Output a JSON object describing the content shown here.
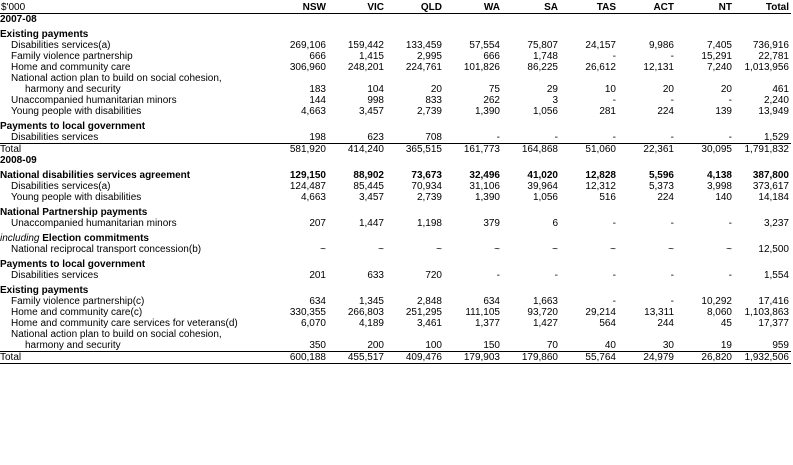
{
  "header": {
    "unit": "$'000",
    "columns": [
      "NSW",
      "VIC",
      "QLD",
      "WA",
      "SA",
      "TAS",
      "ACT",
      "NT",
      "Total"
    ]
  },
  "rows": [
    {
      "kind": "year",
      "label": "2007-08"
    },
    {
      "kind": "section",
      "label": "Existing payments"
    },
    {
      "kind": "item",
      "label": "Disabilities services(a)",
      "values": [
        "269,106",
        "159,442",
        "133,459",
        "57,554",
        "75,807",
        "24,157",
        "9,986",
        "7,405",
        "736,916"
      ]
    },
    {
      "kind": "item",
      "label": "Family violence partnership",
      "values": [
        "666",
        "1,415",
        "2,995",
        "666",
        "1,748",
        "-",
        "-",
        "15,291",
        "22,781"
      ]
    },
    {
      "kind": "item",
      "label": "Home and community care",
      "values": [
        "306,960",
        "248,201",
        "224,761",
        "101,826",
        "86,225",
        "26,612",
        "12,131",
        "7,240",
        "1,013,956"
      ]
    },
    {
      "kind": "item",
      "label": "National action plan to build on social cohesion,"
    },
    {
      "kind": "item-sub",
      "label": "harmony and security",
      "values": [
        "183",
        "104",
        "20",
        "75",
        "29",
        "10",
        "20",
        "20",
        "461"
      ]
    },
    {
      "kind": "item",
      "label": "Unaccompanied humanitarian minors",
      "values": [
        "144",
        "998",
        "833",
        "262",
        "3",
        "-",
        "-",
        "-",
        "2,240"
      ]
    },
    {
      "kind": "item",
      "label": "Young people with disabilities",
      "values": [
        "4,663",
        "3,457",
        "2,739",
        "1,390",
        "1,056",
        "281",
        "224",
        "139",
        "13,949"
      ]
    },
    {
      "kind": "section",
      "label": "Payments to local government"
    },
    {
      "kind": "item",
      "label": "Disabilities services",
      "values": [
        "198",
        "623",
        "708",
        "-",
        "-",
        "-",
        "-",
        "-",
        "1,529"
      ]
    },
    {
      "kind": "total",
      "label": "Total",
      "values": [
        "581,920",
        "414,240",
        "365,515",
        "161,773",
        "164,868",
        "51,060",
        "22,361",
        "30,095",
        "1,791,832"
      ]
    },
    {
      "kind": "year",
      "label": "2008-09"
    },
    {
      "kind": "section",
      "label": "National disabilities services agreement",
      "values": [
        "129,150",
        "88,902",
        "73,673",
        "32,496",
        "41,020",
        "12,828",
        "5,596",
        "4,138",
        "387,800"
      ]
    },
    {
      "kind": "item",
      "label": "Disabilities services(a)",
      "values": [
        "124,487",
        "85,445",
        "70,934",
        "31,106",
        "39,964",
        "12,312",
        "5,373",
        "3,998",
        "373,617"
      ]
    },
    {
      "kind": "item",
      "label": "Young people with disabilities",
      "values": [
        "4,663",
        "3,457",
        "2,739",
        "1,390",
        "1,056",
        "516",
        "224",
        "140",
        "14,184"
      ]
    },
    {
      "kind": "section",
      "label": "National Partnership payments"
    },
    {
      "kind": "item",
      "label": "Unaccompanied humanitarian minors",
      "values": [
        "207",
        "1,447",
        "1,198",
        "379",
        "6",
        "-",
        "-",
        "-",
        "3,237"
      ]
    },
    {
      "kind": "section-ital",
      "label_ital": "including",
      "label": "Election commitments"
    },
    {
      "kind": "item",
      "label": "National reciprocal transport concession(b)",
      "values": [
        "~",
        "~",
        "~",
        "~",
        "~",
        "~",
        "~",
        "~",
        "12,500"
      ]
    },
    {
      "kind": "section",
      "label": "Payments to local government"
    },
    {
      "kind": "item",
      "label": "Disabilities services",
      "values": [
        "201",
        "633",
        "720",
        "-",
        "-",
        "-",
        "-",
        "-",
        "1,554"
      ]
    },
    {
      "kind": "section",
      "label": "Existing payments"
    },
    {
      "kind": "item",
      "label": "Family violence partnership(c)",
      "values": [
        "634",
        "1,345",
        "2,848",
        "634",
        "1,663",
        "-",
        "-",
        "10,292",
        "17,416"
      ]
    },
    {
      "kind": "item",
      "label": "Home and community care(c)",
      "values": [
        "330,355",
        "266,803",
        "251,295",
        "111,105",
        "93,720",
        "29,214",
        "13,311",
        "8,060",
        "1,103,863"
      ]
    },
    {
      "kind": "item",
      "label": "Home and community care services for veterans(d)",
      "values": [
        "6,070",
        "4,189",
        "3,461",
        "1,377",
        "1,427",
        "564",
        "244",
        "45",
        "17,377"
      ]
    },
    {
      "kind": "item",
      "label": "National action plan to build on social cohesion,"
    },
    {
      "kind": "item-sub",
      "label": "harmony and security",
      "values": [
        "350",
        "200",
        "100",
        "150",
        "70",
        "40",
        "30",
        "19",
        "959"
      ]
    },
    {
      "kind": "total-final",
      "label": "Total",
      "values": [
        "600,188",
        "455,517",
        "409,476",
        "179,903",
        "179,860",
        "55,764",
        "24,979",
        "26,820",
        "1,932,506"
      ]
    }
  ]
}
